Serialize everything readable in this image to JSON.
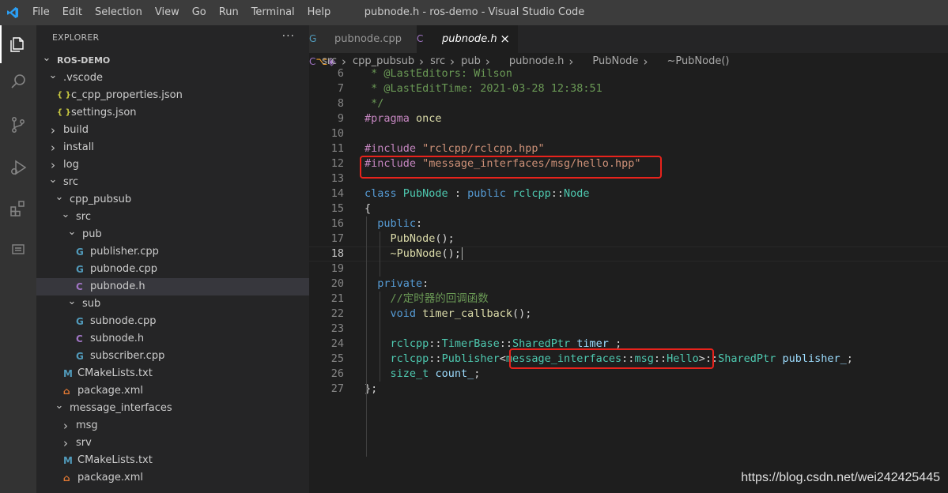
{
  "menu": [
    "File",
    "Edit",
    "Selection",
    "View",
    "Go",
    "Run",
    "Terminal",
    "Help"
  ],
  "window_title": "pubnode.h - ros-demo - Visual Studio Code",
  "activity_icons": [
    "explorer-icon",
    "search-icon",
    "source-control-icon",
    "run-debug-icon",
    "extensions-icon",
    "remote-explorer-icon"
  ],
  "sidebar": {
    "header": "EXPLORER",
    "more": "···",
    "tree": [
      {
        "label": "ROS-DEMO",
        "indent": 0,
        "chev": "open",
        "icon": "",
        "bold": true
      },
      {
        "label": ".vscode",
        "indent": 1,
        "chev": "open",
        "icon": ""
      },
      {
        "label": "c_cpp_properties.json",
        "indent": 2,
        "chev": "",
        "icon": "json"
      },
      {
        "label": "settings.json",
        "indent": 2,
        "chev": "",
        "icon": "json"
      },
      {
        "label": "build",
        "indent": 1,
        "chev": "closed",
        "icon": ""
      },
      {
        "label": "install",
        "indent": 1,
        "chev": "closed",
        "icon": ""
      },
      {
        "label": "log",
        "indent": 1,
        "chev": "closed",
        "icon": ""
      },
      {
        "label": "src",
        "indent": 1,
        "chev": "open",
        "icon": ""
      },
      {
        "label": "cpp_pubsub",
        "indent": 2,
        "chev": "open",
        "icon": ""
      },
      {
        "label": "src",
        "indent": 3,
        "chev": "open",
        "icon": ""
      },
      {
        "label": "pub",
        "indent": 4,
        "chev": "open",
        "icon": ""
      },
      {
        "label": "publisher.cpp",
        "indent": 5,
        "chev": "",
        "icon": "cpp"
      },
      {
        "label": "pubnode.cpp",
        "indent": 5,
        "chev": "",
        "icon": "cpp"
      },
      {
        "label": "pubnode.h",
        "indent": 5,
        "chev": "",
        "icon": "h",
        "selected": true
      },
      {
        "label": "sub",
        "indent": 4,
        "chev": "open",
        "icon": ""
      },
      {
        "label": "subnode.cpp",
        "indent": 5,
        "chev": "",
        "icon": "cpp"
      },
      {
        "label": "subnode.h",
        "indent": 5,
        "chev": "",
        "icon": "h"
      },
      {
        "label": "subscriber.cpp",
        "indent": 5,
        "chev": "",
        "icon": "cpp"
      },
      {
        "label": "CMakeLists.txt",
        "indent": 3,
        "chev": "",
        "icon": "cmake"
      },
      {
        "label": "package.xml",
        "indent": 3,
        "chev": "",
        "icon": "xml"
      },
      {
        "label": "message_interfaces",
        "indent": 2,
        "chev": "open",
        "icon": ""
      },
      {
        "label": "msg",
        "indent": 3,
        "chev": "closed",
        "icon": ""
      },
      {
        "label": "srv",
        "indent": 3,
        "chev": "closed",
        "icon": ""
      },
      {
        "label": "CMakeLists.txt",
        "indent": 3,
        "chev": "",
        "icon": "cmake"
      },
      {
        "label": "package.xml",
        "indent": 3,
        "chev": "",
        "icon": "xml"
      }
    ]
  },
  "tabs": [
    {
      "label": "pubnode.cpp",
      "icon": "cpp",
      "active": false
    },
    {
      "label": "pubnode.h",
      "icon": "h",
      "active": true,
      "close": "×"
    }
  ],
  "breadcrumb": [
    {
      "label": "src"
    },
    {
      "label": "cpp_pubsub"
    },
    {
      "label": "src"
    },
    {
      "label": "pub"
    },
    {
      "label": "pubnode.h",
      "icon": "h"
    },
    {
      "label": "PubNode",
      "icon": "class"
    },
    {
      "label": "~PubNode()",
      "icon": "method"
    }
  ],
  "current_line": 18,
  "code": [
    {
      "n": 6,
      "tokens": [
        [
          " * @LastEditors: Wilson",
          "comment"
        ]
      ]
    },
    {
      "n": 7,
      "tokens": [
        [
          " * @LastEditTime: 2021-03-28 12:38:51",
          "comment"
        ]
      ]
    },
    {
      "n": 8,
      "tokens": [
        [
          " */",
          "comment"
        ]
      ]
    },
    {
      "n": 9,
      "tokens": [
        [
          "#pragma",
          "pre"
        ],
        [
          " once",
          "fn"
        ]
      ]
    },
    {
      "n": 10,
      "tokens": []
    },
    {
      "n": 11,
      "tokens": [
        [
          "#include",
          "pre"
        ],
        [
          " \"rclcpp/rclcpp.hpp\"",
          "str"
        ]
      ]
    },
    {
      "n": 12,
      "tokens": [
        [
          "#include",
          "pre"
        ],
        [
          " \"message_interfaces/msg/hello.hpp\"",
          "str"
        ]
      ]
    },
    {
      "n": 13,
      "tokens": []
    },
    {
      "n": 14,
      "tokens": [
        [
          "class",
          "kw"
        ],
        [
          " ",
          "plain"
        ],
        [
          "PubNode",
          "type"
        ],
        [
          " : ",
          "plain"
        ],
        [
          "public",
          "kw"
        ],
        [
          " ",
          "plain"
        ],
        [
          "rclcpp",
          "type"
        ],
        [
          "::",
          "plain"
        ],
        [
          "Node",
          "type"
        ]
      ]
    },
    {
      "n": 15,
      "tokens": [
        [
          "{",
          "plain"
        ]
      ]
    },
    {
      "n": 16,
      "tokens": [
        [
          "  ",
          "plain"
        ],
        [
          "public",
          "kw"
        ],
        [
          ":",
          "plain"
        ]
      ]
    },
    {
      "n": 17,
      "tokens": [
        [
          "    ",
          "plain"
        ],
        [
          "PubNode",
          "fn"
        ],
        [
          "();",
          "plain"
        ]
      ]
    },
    {
      "n": 18,
      "tokens": [
        [
          "    ",
          "plain"
        ],
        [
          "~PubNode",
          "fn"
        ],
        [
          "();",
          "plain"
        ]
      ]
    },
    {
      "n": 19,
      "tokens": []
    },
    {
      "n": 20,
      "tokens": [
        [
          "  ",
          "plain"
        ],
        [
          "private",
          "kw"
        ],
        [
          ":",
          "plain"
        ]
      ]
    },
    {
      "n": 21,
      "tokens": [
        [
          "    ",
          "plain"
        ],
        [
          "//定时器的回调函数",
          "comment"
        ]
      ]
    },
    {
      "n": 22,
      "tokens": [
        [
          "    ",
          "plain"
        ],
        [
          "void",
          "kw"
        ],
        [
          " ",
          "plain"
        ],
        [
          "timer_callback",
          "fn"
        ],
        [
          "();",
          "plain"
        ]
      ]
    },
    {
      "n": 23,
      "tokens": []
    },
    {
      "n": 24,
      "tokens": [
        [
          "    ",
          "plain"
        ],
        [
          "rclcpp",
          "type"
        ],
        [
          "::",
          "plain"
        ],
        [
          "TimerBase",
          "type"
        ],
        [
          "::",
          "plain"
        ],
        [
          "SharedPtr",
          "type"
        ],
        [
          " ",
          "plain"
        ],
        [
          "timer_",
          "var"
        ],
        [
          ";",
          "plain"
        ]
      ]
    },
    {
      "n": 25,
      "tokens": [
        [
          "    ",
          "plain"
        ],
        [
          "rclcpp",
          "type"
        ],
        [
          "::",
          "plain"
        ],
        [
          "Publisher",
          "type"
        ],
        [
          "<",
          "plain"
        ],
        [
          "message_interfaces",
          "type"
        ],
        [
          "::",
          "plain"
        ],
        [
          "msg",
          "type"
        ],
        [
          "::",
          "plain"
        ],
        [
          "Hello",
          "type"
        ],
        [
          ">",
          "plain"
        ],
        [
          "::",
          "plain"
        ],
        [
          "SharedPtr",
          "type"
        ],
        [
          " ",
          "plain"
        ],
        [
          "publisher_",
          "var"
        ],
        [
          ";",
          "plain"
        ]
      ]
    },
    {
      "n": 26,
      "tokens": [
        [
          "    ",
          "plain"
        ],
        [
          "size_t",
          "type"
        ],
        [
          " ",
          "plain"
        ],
        [
          "count_",
          "var"
        ],
        [
          ";",
          "plain"
        ]
      ]
    },
    {
      "n": 27,
      "tokens": [
        [
          "};",
          "plain"
        ]
      ]
    }
  ],
  "annotation_color": "#e8231c",
  "watermark": "https://blog.csdn.net/wei242425445"
}
